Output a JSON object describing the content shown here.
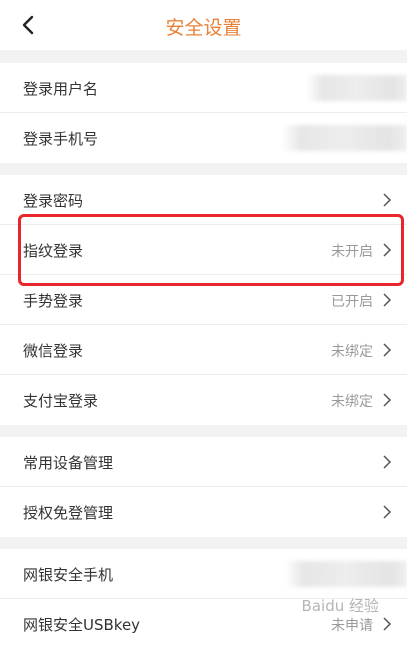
{
  "header": {
    "title": "安全设置",
    "back_icon": "chevron-left-icon"
  },
  "colors": {
    "accent": "#e8823a",
    "highlight": "#e8262b"
  },
  "groups": [
    {
      "rows": [
        {
          "label": "登录用户名",
          "value": "",
          "obscured": true
        },
        {
          "label": "登录手机号",
          "value": "",
          "obscured": true
        }
      ]
    },
    {
      "rows": [
        {
          "label": "登录密码",
          "value": ""
        },
        {
          "label": "指纹登录",
          "value": "未开启"
        },
        {
          "label": "手势登录",
          "value": "已开启"
        },
        {
          "label": "微信登录",
          "value": "未绑定"
        },
        {
          "label": "支付宝登录",
          "value": "未绑定"
        }
      ]
    },
    {
      "rows": [
        {
          "label": "常用设备管理",
          "value": ""
        },
        {
          "label": "授权免登管理",
          "value": ""
        }
      ]
    },
    {
      "rows": [
        {
          "label": "网银安全手机",
          "value": "",
          "obscured": true
        },
        {
          "label": "网银安全USBkey",
          "value": "未申请"
        }
      ]
    }
  ],
  "watermark": "Baidu 经验"
}
